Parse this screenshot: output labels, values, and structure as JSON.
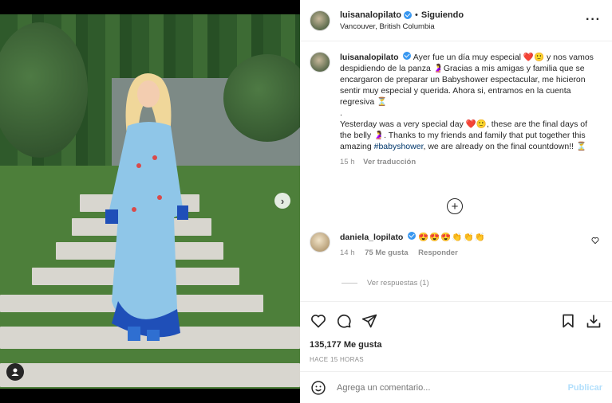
{
  "post": {
    "username": "luisanalopilato",
    "follow_status": "Siguiendo",
    "dot": "•",
    "location": "Vancouver, British Columbia"
  },
  "caption": {
    "username": "luisanalopilato",
    "text_es_1": "Ayer fue un día muy especial ❤️🙂 y nos vamos despidiendo de la panza 🤰Gracias a mis amigas y familia que se encargaron de preparar un Babyshower espectacular, me hicieron sentir muy especial y querida. Ahora si, entramos en la cuenta regresiva ⏳",
    "dot_line": ".",
    "text_en_1": "Yesterday was a very special day ❤️🙂, these are the final days of the belly 🤰. Thanks to my friends and family that put together this amazing ",
    "hashtag": "#babyshower",
    "text_en_2": ", we are already on the final countdown!! ⏳",
    "time": "15 h",
    "see_translation": "Ver traducción"
  },
  "comment": {
    "username": "daniela_lopilato",
    "emojis": "😍😍😍👏👏👏",
    "time": "14 h",
    "likes": "75 Me gusta",
    "reply": "Responder",
    "view_replies": "Ver respuestas (1)"
  },
  "actions": {
    "likes_count": "135,177 Me gusta",
    "time_ago": "HACE 15 HORAS"
  },
  "add_comment": {
    "placeholder": "Agrega un comentario...",
    "publish": "Publicar"
  },
  "icons": [
    "heart-icon",
    "comment-icon",
    "share-icon",
    "bookmark-icon",
    "download-icon",
    "emoji-icon",
    "more-icon",
    "plus-circle-icon",
    "next-arrow-icon",
    "user-tag-icon"
  ]
}
